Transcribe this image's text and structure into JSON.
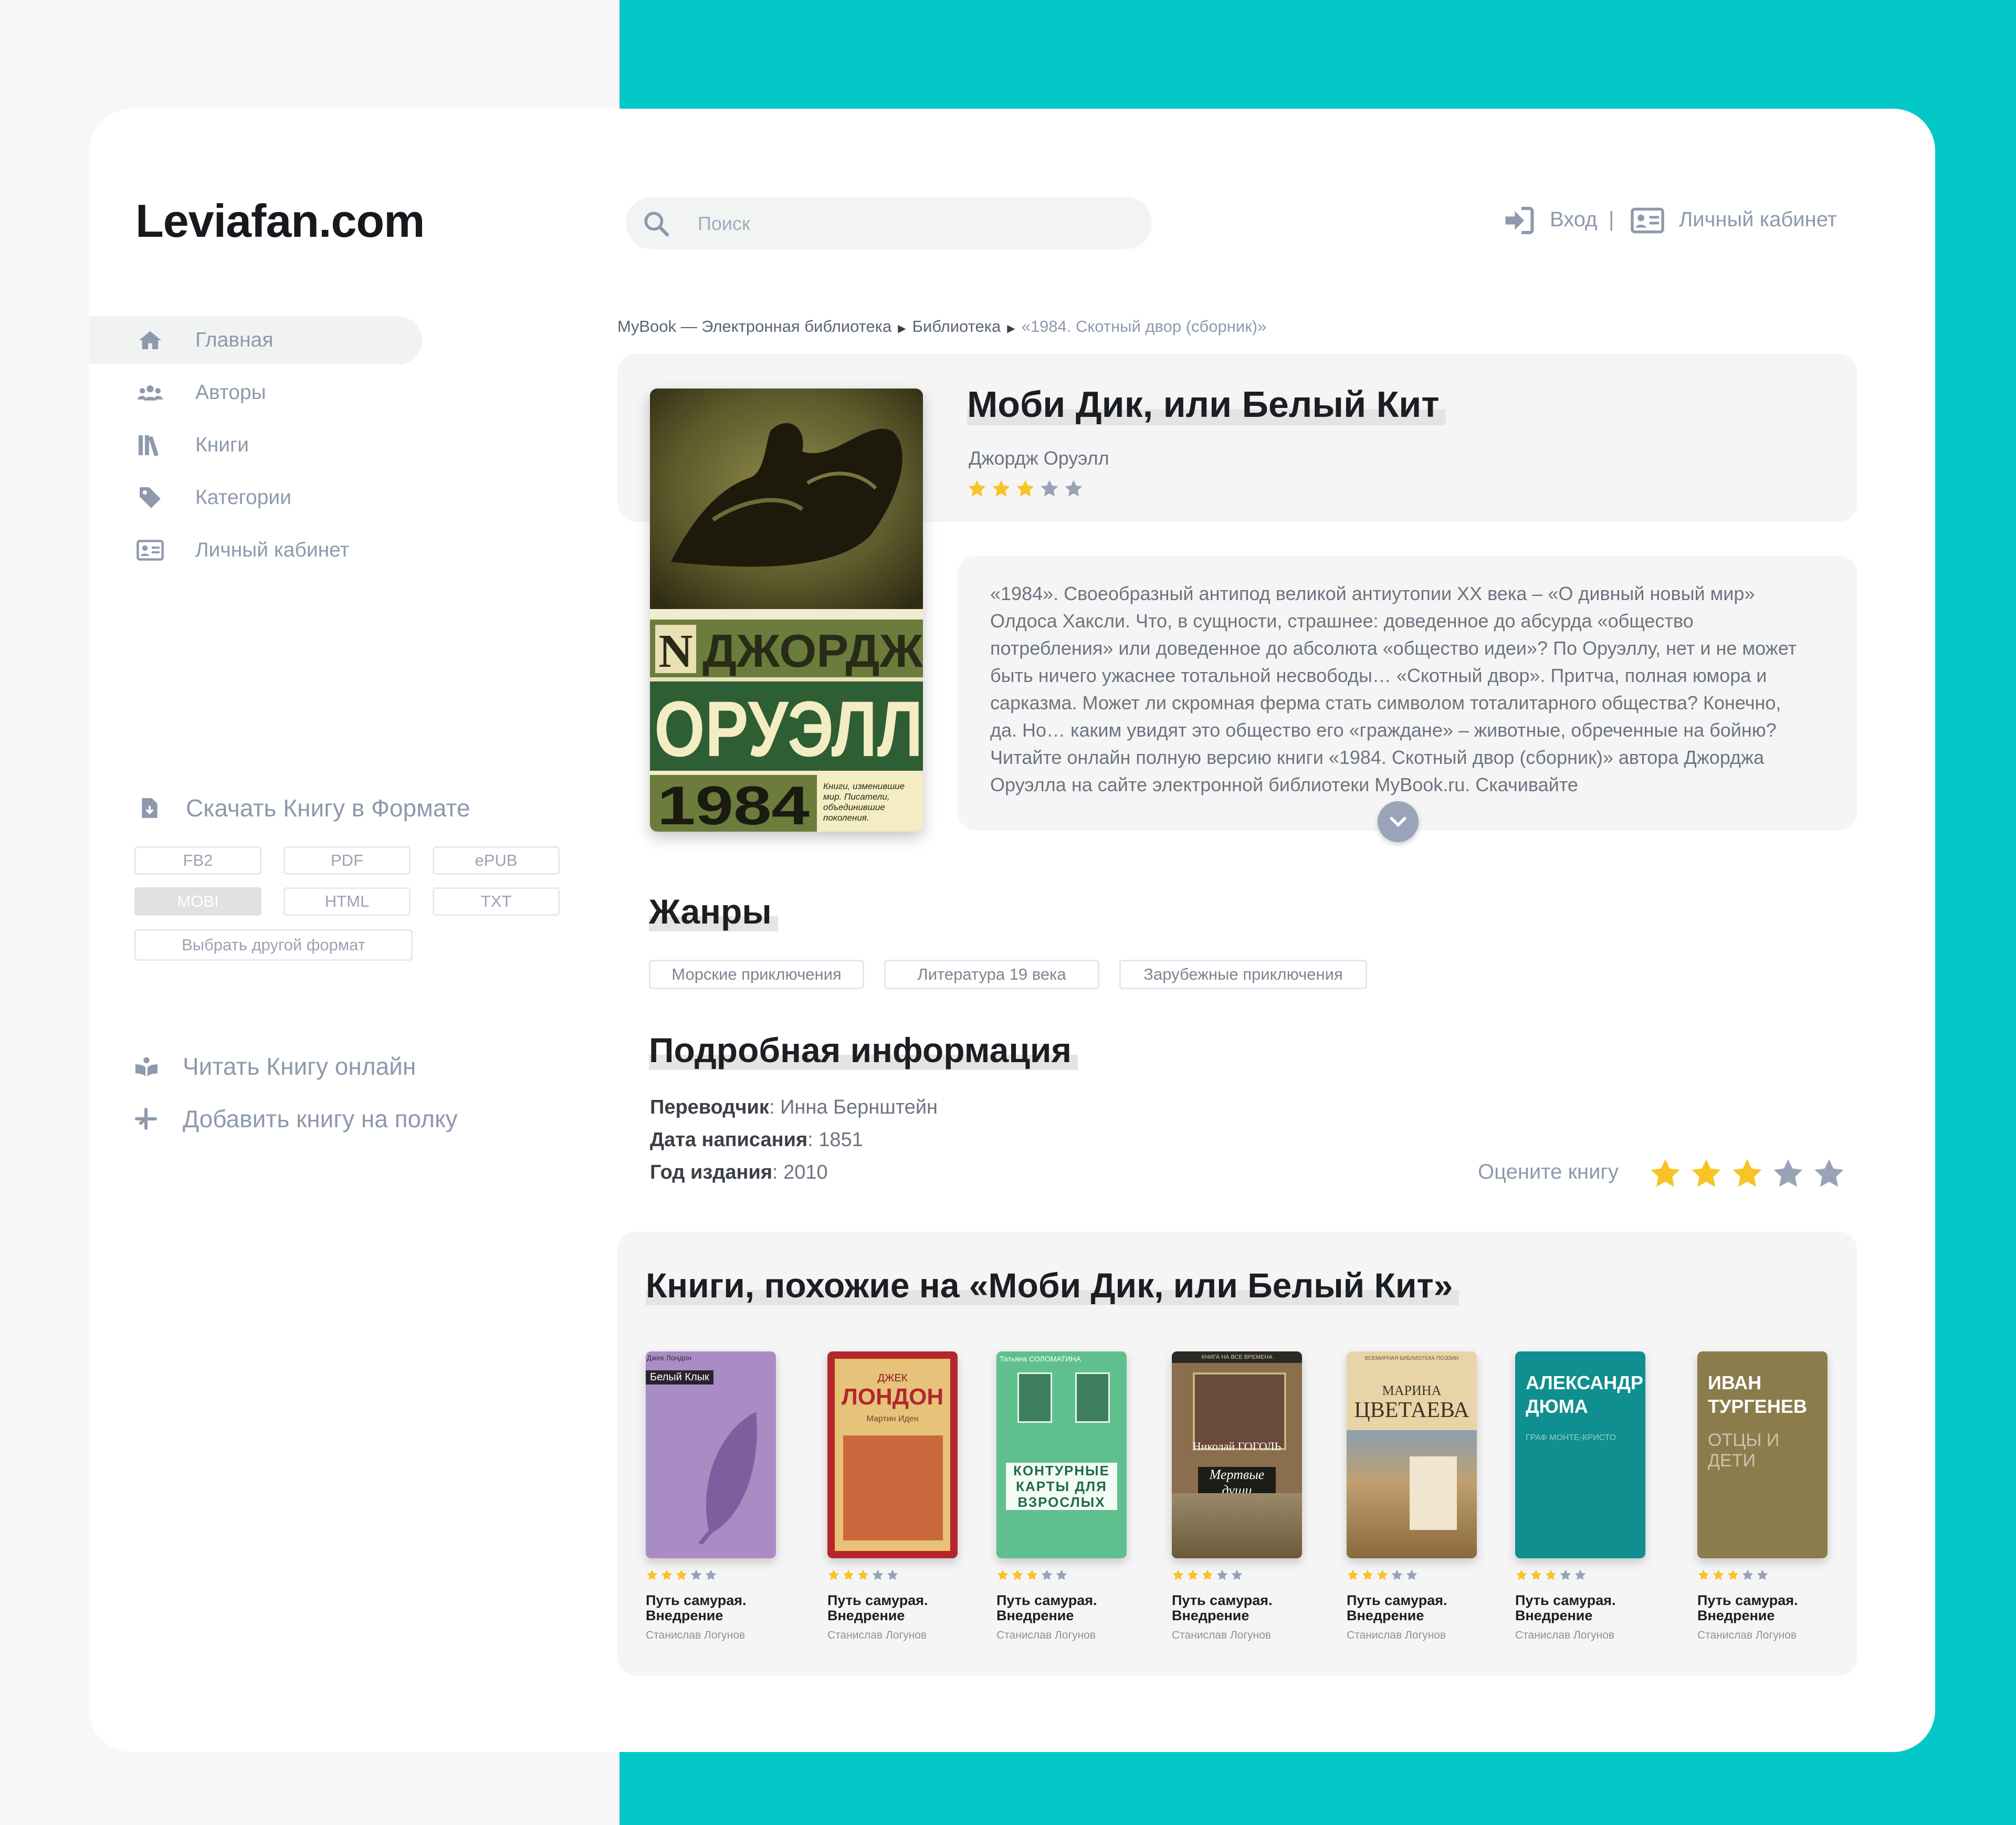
{
  "site": {
    "logo": "Leviafan.com"
  },
  "search": {
    "placeholder": "Поиск"
  },
  "top_nav": {
    "login": "Вход",
    "separator": "|",
    "cabinet": "Личный кабинет"
  },
  "sidebar": {
    "items": [
      {
        "label": "Главная",
        "icon": "home-icon",
        "active": true
      },
      {
        "label": "Авторы",
        "icon": "users-icon"
      },
      {
        "label": "Книги",
        "icon": "books-icon"
      },
      {
        "label": "Категории",
        "icon": "tag-icon"
      },
      {
        "label": "Личный кабинет",
        "icon": "id-card-icon"
      }
    ],
    "download": {
      "title": "Скачать Книгу в Формате",
      "formats": [
        "FB2",
        "PDF",
        "ePUB",
        "MOBI",
        "HTML",
        "TXT"
      ],
      "selected": "MOBI",
      "other": "Выбрать другой формат"
    },
    "read_online": "Читать Книгу онлайн",
    "add_to_shelf": "Добавить книгу на полку"
  },
  "breadcrumbs": {
    "items": [
      "MyBook — Электронная библиотека",
      "Библиотека"
    ],
    "current": "«1984. Скотный двор (сборник)»"
  },
  "book": {
    "title": "Моби Дик, или Белый Кит",
    "author": "Джордж Оруэлл",
    "rating": 3,
    "rating_max": 5,
    "cover": {
      "author_line": "ДЖОРДЖ",
      "surname": "ОРУЭЛЛ",
      "number": "1984",
      "logo_letter": "N",
      "tagline": "Книги, изменившие мир. Писатели, объединившие поколения."
    },
    "description": "«1984». Своеобразный антипод великой антиутопии XX века – «О дивный новый мир» Олдоса Хаксли. Что, в сущности, страшнее: доведенное до абсурда «общество потребления» или доведенное до абсолюта «общество идеи»? По Оруэллу, нет и не может быть ничего ужаснее тотальной несвободы… «Скотный двор». Притча, полная юмора и сарказма. Может ли скромная ферма стать символом тоталитарного общества? Конечно, да. Но… каким увидят это общество его «граждане» – животные, обреченные на бойню? Читайте онлайн полную версию книги «1984. Скотный двор (сборник)» автора Джорджа Оруэлла на сайте электронной библиотеки MyBook.ru. Скачивайте"
  },
  "genres": {
    "title": "Жанры",
    "items": [
      "Морские приключения",
      "Литература 19 века",
      "Зарубежные приключения"
    ]
  },
  "details": {
    "title": "Подробная информация",
    "translator_label": "Переводчик",
    "translator": "Инна Бернштейн",
    "written_label": "Дата написания",
    "written": "1851",
    "published_label": "Год издания",
    "published": "2010",
    "rate_label": "Оцените книгу",
    "user_rating": 3
  },
  "similar": {
    "title": "Книги, похожие на «Моби Дик, или Белый Кит»",
    "books": [
      {
        "title": "Путь самурая. Внедрение",
        "author": "Станислав Логунов",
        "rating": 3,
        "cover_author": "Джек Лондон",
        "cover_title": "Белый Клык",
        "color": "#a98cc4"
      },
      {
        "title": "Путь самурая. Внедрение",
        "author": "Станислав Логунов",
        "rating": 3,
        "cover_author": "ДЖЕК",
        "cover_title": "ЛОНДОН",
        "cover_sub": "Мартин Иден",
        "color": "#b3262d"
      },
      {
        "title": "Путь самурая. Внедрение",
        "author": "Станислав Логунов",
        "rating": 3,
        "cover_author": "Татьяна СОЛОМАТИНА",
        "cover_title": "КОНТУРНЫЕ КАРТЫ ДЛЯ ВЗРОСЛЫХ",
        "color": "#5fc08e"
      },
      {
        "title": "Путь самурая. Внедрение",
        "author": "Станислав Логунов",
        "rating": 3,
        "cover_author": "Николай ГОГОЛЬ",
        "cover_title": "Мертвые души",
        "cover_top": "КНИГА НА ВСЕ ВРЕМЕНА",
        "color": "#8a6e4e"
      },
      {
        "title": "Путь самурая. Внедрение",
        "author": "Станислав Логунов",
        "rating": 3,
        "cover_author": "МАРИНА",
        "cover_title": "ЦВЕТАЕВА",
        "cover_top": "ВСЕМИРНАЯ БИБЛИОТЕКА ПОЭЗИИ",
        "color": "#e9d4a8"
      },
      {
        "title": "Путь самурая. Внедрение",
        "author": "Станислав Логунов",
        "rating": 3,
        "cover_author": "АЛЕКСАНДР",
        "cover_title": "ДЮМА",
        "cover_sub": "ГРАФ МОНТЕ-КРИСТО",
        "color": "#0f8f8f"
      },
      {
        "title": "Путь самурая. Внедрение",
        "author": "Станислав Логунов",
        "rating": 3,
        "cover_author": "ИВАН",
        "cover_title": "ТУРГЕНЕВ",
        "cover_sub": "ОТЦЫ И ДЕТИ",
        "color": "#8b7c4c"
      }
    ]
  },
  "colors": {
    "accent": "#04c7c7",
    "star_on": "#f7c325",
    "star_off": "#97a3b6",
    "muted": "#8e99ad"
  }
}
